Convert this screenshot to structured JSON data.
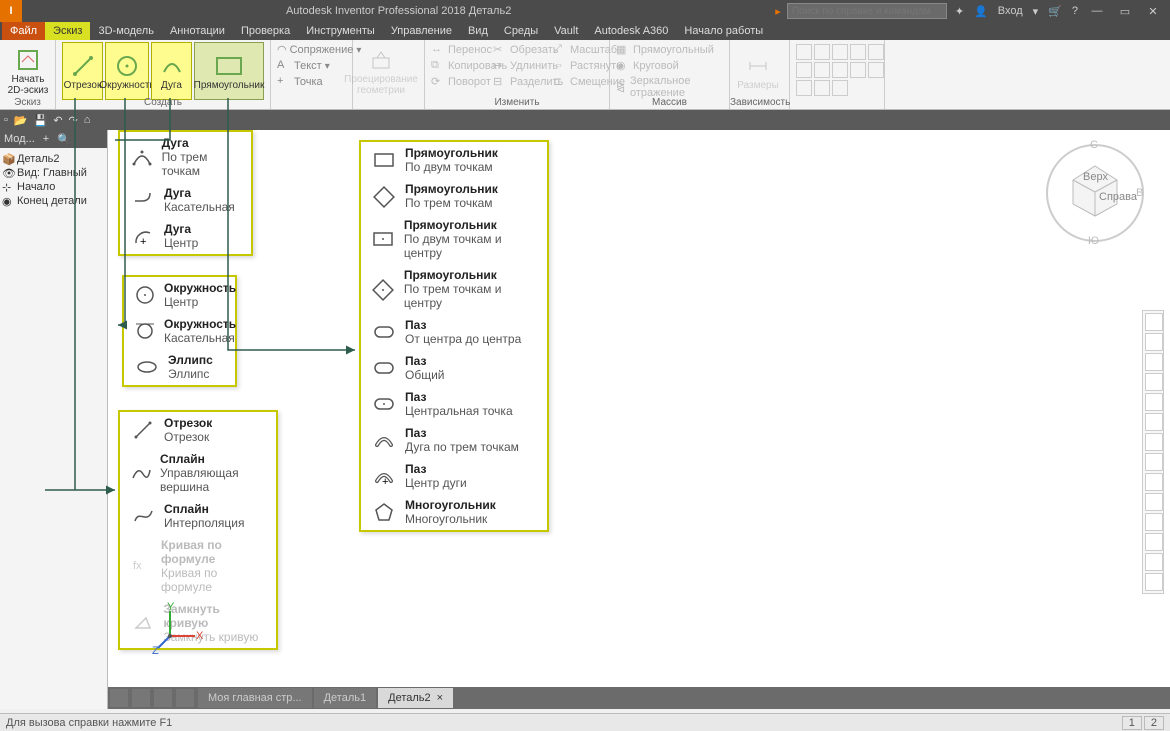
{
  "title": "Autodesk Inventor Professional 2018   Деталь2",
  "search_placeholder": "Поиск по справке и командам",
  "login": "Вход",
  "menu": {
    "file": "Файл",
    "items": [
      "Эскиз",
      "3D-модель",
      "Аннотации",
      "Проверка",
      "Инструменты",
      "Управление",
      "Вид",
      "Среды",
      "Vault",
      "Autodesk A360",
      "Начало работы"
    ]
  },
  "ribbon": {
    "sketch": {
      "big": "Начать 2D-эскиз",
      "label": "Эскиз"
    },
    "draw": {
      "line": "Отрезок",
      "circle": "Окружность",
      "arc": "Дуга",
      "rect": "Прямоугольник",
      "sop": "Сопряжение",
      "text": "Текст",
      "point": "Точка",
      "label": "Создать"
    },
    "project": {
      "name": "Проецирование геометрии"
    },
    "modify": {
      "items": [
        "Перенос",
        "Обрезать",
        "Масштаб",
        "Копировать",
        "Удлинить",
        "Растянуть",
        "Поворот",
        "Разделить",
        "Смещение"
      ],
      "label": "Изменить"
    },
    "pattern": {
      "items": [
        "Прямоугольный",
        "Круговой",
        "Зеркальное отражение"
      ],
      "label": "Массив"
    },
    "dim": {
      "name": "Размеры",
      "label": "Зависимость"
    }
  },
  "modelpanel": {
    "header": "Мод...",
    "nodes": [
      "Деталь2",
      "Вид: Главный",
      "Начало",
      "Конец детали"
    ]
  },
  "popup_arc": [
    {
      "t": "Дуга",
      "s": "По трем точкам"
    },
    {
      "t": "Дуга",
      "s": "Касательная"
    },
    {
      "t": "Дуга",
      "s": "Центр"
    }
  ],
  "popup_circle": [
    {
      "t": "Окружность",
      "s": "Центр"
    },
    {
      "t": "Окружность",
      "s": "Касательная"
    },
    {
      "t": "Эллипс",
      "s": "Эллипс"
    }
  ],
  "popup_line": [
    {
      "t": "Отрезок",
      "s": "Отрезок"
    },
    {
      "t": "Сплайн",
      "s": "Управляющая вершина"
    },
    {
      "t": "Сплайн",
      "s": "Интерполяция"
    },
    {
      "t": "Кривая по формуле",
      "s": "Кривая по формуле",
      "dis": true
    },
    {
      "t": "Замкнуть кривую",
      "s": "Замкнуть кривую",
      "dis": true
    }
  ],
  "popup_rect": [
    {
      "t": "Прямоугольник",
      "s": "По двум точкам"
    },
    {
      "t": "Прямоугольник",
      "s": "По трем точкам"
    },
    {
      "t": "Прямоугольник",
      "s": "По двум точкам и центру"
    },
    {
      "t": "Прямоугольник",
      "s": "По трем точкам и центру"
    },
    {
      "t": "Паз",
      "s": "От центра до центра"
    },
    {
      "t": "Паз",
      "s": "Общий"
    },
    {
      "t": "Паз",
      "s": "Центральная точка"
    },
    {
      "t": "Паз",
      "s": "Дуга по трем точкам"
    },
    {
      "t": "Паз",
      "s": "Центр дуги"
    },
    {
      "t": "Многоугольник",
      "s": "Многоугольник"
    }
  ],
  "tabs": [
    "Моя главная стр...",
    "Деталь1",
    "Деталь2"
  ],
  "status": "Для вызова справки нажмите F1",
  "statusnums": [
    "1",
    "2"
  ],
  "viewcube": {
    "top": "Верх",
    "right": "Справа"
  },
  "axis": {
    "x": "X",
    "y": "Y",
    "z": "Z"
  }
}
